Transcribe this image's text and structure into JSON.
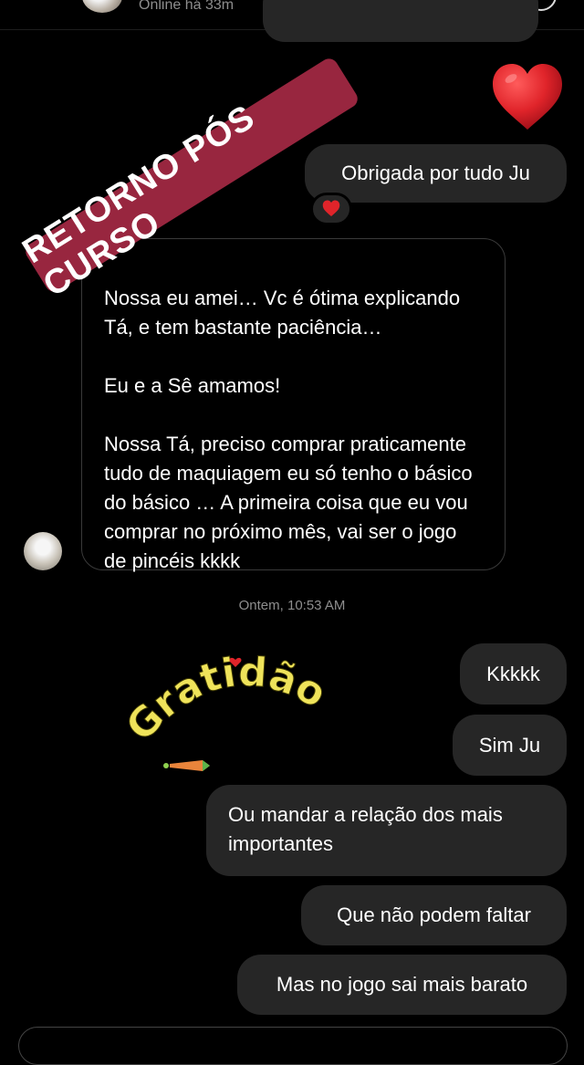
{
  "header": {
    "status": "Online há 33m"
  },
  "overlay": {
    "stamp_text": "RETORNO PÓS CURSO"
  },
  "messages": {
    "out_1": "Obrigada por tudo Ju",
    "incoming_lines": [
      "Nossa eu amei… Vc é ótima explicando Tá, e tem bastante paciência…",
      "Eu e a Sê amamos!",
      "Nossa Tá, preciso comprar praticamente tudo de maquiagem eu só tenho o básico do básico … A primeira coisa que eu vou comprar no próximo mês, vai ser o jogo de pincéis kkkk"
    ],
    "timestamp": "Ontem, 10:53 AM",
    "sticker_text": "Gratidão",
    "out_2": "Kkkkk",
    "out_3": "Sim Ju",
    "out_4": "Ou mandar a relação dos mais importantes",
    "out_5": "Que não podem faltar",
    "out_6": "Mas no jogo sai mais barato"
  },
  "colors": {
    "background": "#000000",
    "bubble_out": "#262626",
    "stamp": "#98263f",
    "sticker_text": "#efe35a",
    "heart": "#e0242a"
  },
  "icons": {
    "big_heart": "red-heart-icon",
    "reaction": "heart-reaction-icon"
  }
}
